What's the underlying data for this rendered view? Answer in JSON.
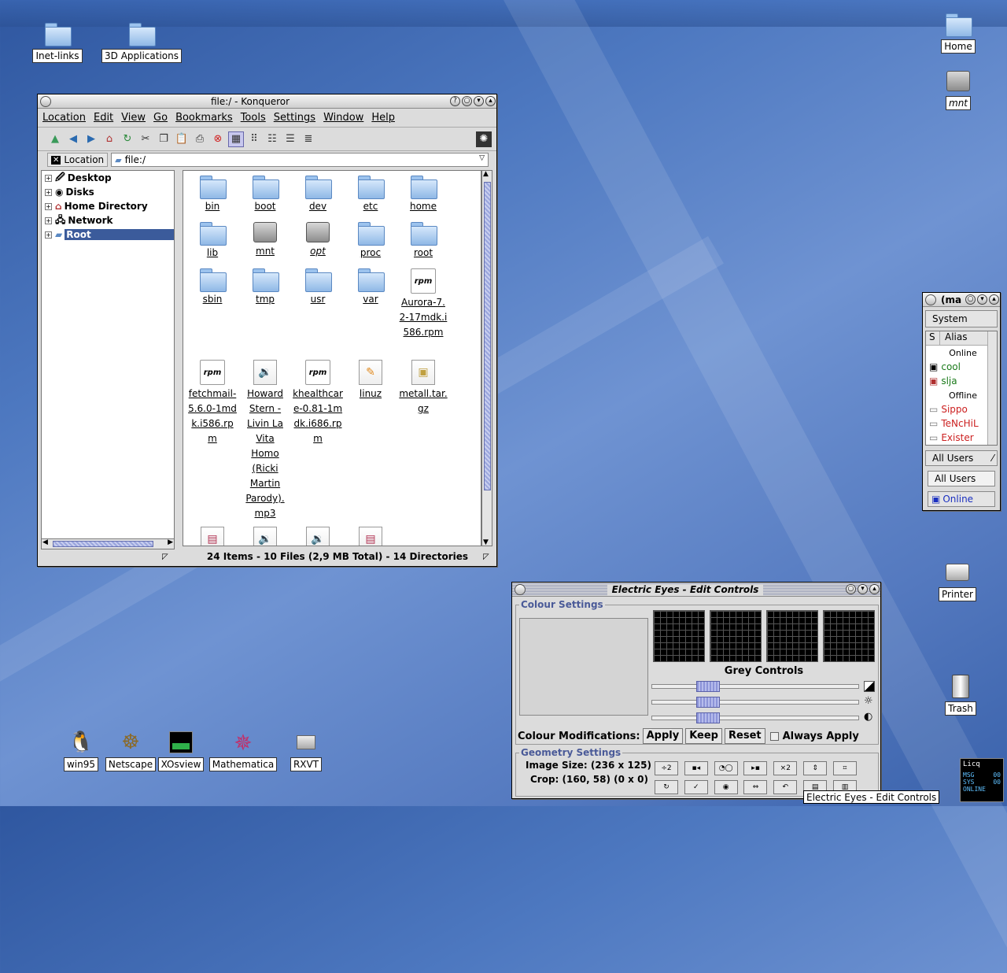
{
  "desktop": {
    "icons": {
      "inet_links": "Inet-links",
      "apps_3d": "3D Applications",
      "home": "Home",
      "mnt": "mnt",
      "printer": "Printer",
      "trash": "Trash",
      "win95": "win95",
      "netscape": "Netscape",
      "xosview": "XOsview",
      "mathematica": "Mathematica",
      "rxvt": "RXVT"
    }
  },
  "konqueror": {
    "title": "file:/ - Konqueror",
    "menu": [
      "Location",
      "Edit",
      "View",
      "Go",
      "Bookmarks",
      "Tools",
      "Settings",
      "Window",
      "Help"
    ],
    "location_label": "Location",
    "location_value": "file:/",
    "tree": [
      "Desktop",
      "Disks",
      "Home Directory",
      "Network",
      "Root"
    ],
    "files": {
      "bin": "bin",
      "boot": "boot",
      "dev": "dev",
      "etc": "etc",
      "home": "home",
      "lib": "lib",
      "mnt": "mnt",
      "opt": "opt",
      "proc": "proc",
      "root": "root",
      "sbin": "sbin",
      "tmp": "tmp",
      "usr": "usr",
      "var": "var",
      "aurora": [
        "Aurora-7.",
        "2-17mdk.i",
        "586.rpm"
      ],
      "fetchmail": [
        "fetchmail-",
        "5.6.0-1md",
        "k.i586.rp",
        "m"
      ],
      "howard": [
        "Howard",
        "Stern -",
        "Livin La",
        "Vita",
        "Homo",
        "(Ricki",
        "Martin",
        "Parody).",
        "mp3"
      ],
      "khealthcare": [
        "khealthcar",
        "e-0.81-1m",
        "dk.i686.rp",
        "m"
      ],
      "linuz": [
        "linuz"
      ],
      "metall": [
        "metall.tar.",
        "gz"
      ]
    },
    "status": "24 Items - 10 Files (2,9 MB Total) - 14 Directories"
  },
  "licq": {
    "title": "(ma",
    "system_label": "System",
    "col_s": "S",
    "col_alias": "Alias",
    "online_header": "Online",
    "offline_header": "Offline",
    "online_users": [
      "cool",
      "slja"
    ],
    "offline_users": [
      "Sippo",
      "TeNcHiL",
      "Exister"
    ],
    "group_select": "All Users",
    "group_value": "All Users",
    "status_value": "Online",
    "colors": {
      "online": "#1a7a1a",
      "offline": "#cc2020",
      "status": "#1a2fc0"
    }
  },
  "electric_eyes": {
    "title": "Electric Eyes - Edit Controls",
    "colour_settings": "Colour Settings",
    "grey_controls": "Grey Controls",
    "colour_mods_label": "Colour Modifications:",
    "apply": "Apply",
    "keep": "Keep",
    "reset": "Reset",
    "always_apply": "Always Apply",
    "geometry_settings": "Geometry Settings",
    "image_size": "Image Size: (236 x 125)",
    "crop": "Crop: (160, 58) (0 x 0)"
  },
  "tooltip": "Electric Eyes - Edit Controls",
  "licq_dock": {
    "logo": "Licq",
    "msg": "MSG",
    "msg_val": "00",
    "sys": "SYS",
    "sys_val": "00",
    "state": "ONLINE"
  }
}
